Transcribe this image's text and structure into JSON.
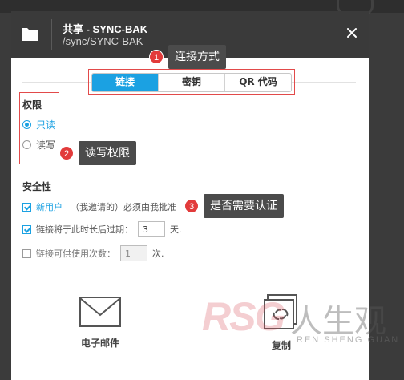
{
  "dialog": {
    "title": "共享 - SYNC-BAK",
    "subtitle": "/sync/SYNC-BAK"
  },
  "tabs": [
    {
      "label": "链接",
      "active": true
    },
    {
      "label": "密钥",
      "active": false
    },
    {
      "label": "QR 代码",
      "active": false
    }
  ],
  "permissions": {
    "heading": "权限",
    "options": [
      {
        "label": "只读",
        "selected": true
      },
      {
        "label": "读写",
        "selected": false
      }
    ]
  },
  "security": {
    "heading": "安全性",
    "new_user": {
      "checked": true,
      "label_main": "新用户",
      "label_paren": "（我邀请的）必须由我批准"
    },
    "expiry": {
      "checked": true,
      "label": "链接将于此时长后过期：",
      "value": "3",
      "unit": "天."
    },
    "usage": {
      "checked": false,
      "label": "链接可供使用次数：",
      "value": "1",
      "unit": "次."
    }
  },
  "share_options": [
    {
      "label": "电子邮件",
      "icon": "email-icon"
    },
    {
      "label": "复制",
      "icon": "copy-icon"
    }
  ],
  "watermark": {
    "logo": "RSG",
    "cn": "人生观",
    "latin": "REN SHENG GUAN"
  },
  "callouts": [
    {
      "number": "1",
      "text": "连接方式"
    },
    {
      "number": "2",
      "text": "读写权限"
    },
    {
      "number": "3",
      "text": "是否需要认证"
    }
  ],
  "colors": {
    "accent": "#1ba1e2",
    "header_bg": "#3a3a3a",
    "callout_badge": "#e23b3b",
    "highlight_border": "#e24a4a"
  }
}
